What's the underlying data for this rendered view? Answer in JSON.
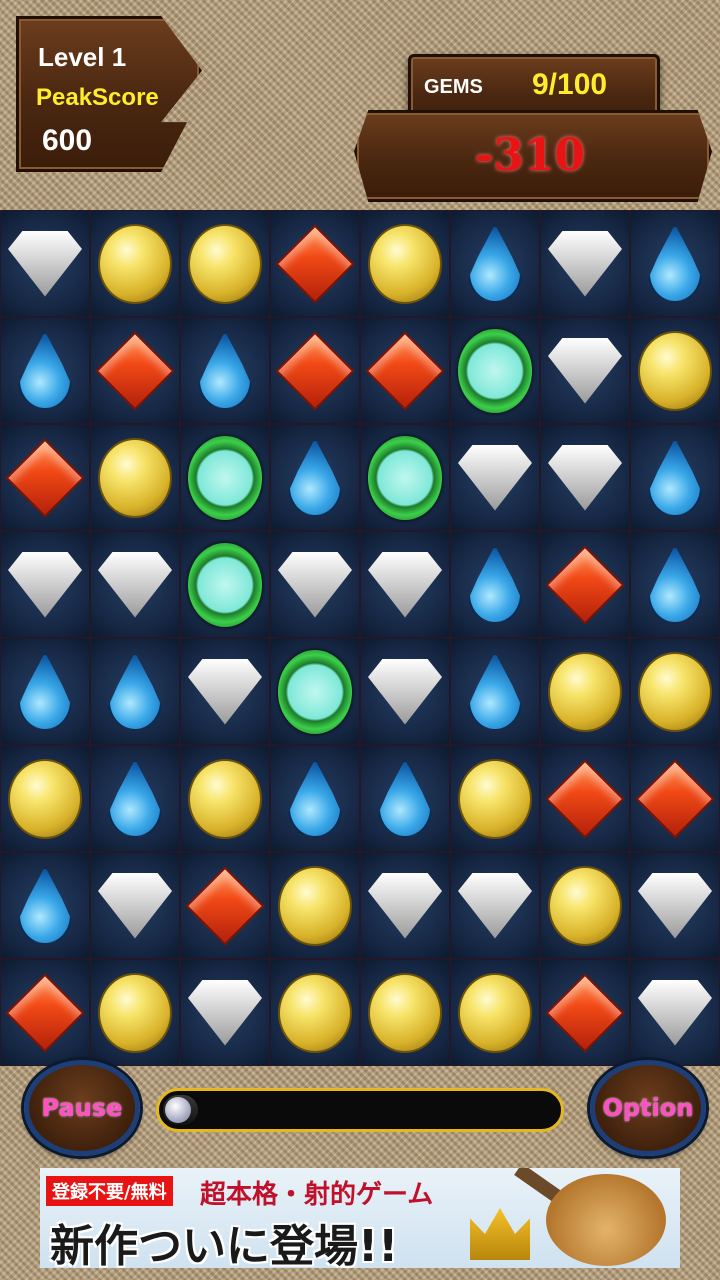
{
  "hud": {
    "level_label": "Level 1",
    "peak_label": "PeakScore",
    "peak_value": "600",
    "gems_label": "GEMS",
    "gems_value": "9/100",
    "score_value": "-310"
  },
  "board": {
    "rows": [
      [
        "white",
        "yellow",
        "yellow",
        "red",
        "yellow",
        "blue",
        "white",
        "blue"
      ],
      [
        "blue",
        "red",
        "blue",
        "red",
        "red",
        "green",
        "white",
        "yellow"
      ],
      [
        "red",
        "yellow",
        "green",
        "blue",
        "green",
        "white",
        "white",
        "blue"
      ],
      [
        "white",
        "white",
        "green",
        "white",
        "white",
        "blue",
        "red",
        "blue"
      ],
      [
        "blue",
        "blue",
        "white",
        "green",
        "white",
        "blue",
        "yellow",
        "yellow"
      ],
      [
        "yellow",
        "blue",
        "yellow",
        "blue",
        "blue",
        "yellow",
        "red",
        "red"
      ],
      [
        "blue",
        "white",
        "red",
        "yellow",
        "white",
        "white",
        "yellow",
        "white"
      ],
      [
        "red",
        "yellow",
        "white",
        "yellow",
        "yellow",
        "yellow",
        "red",
        "white"
      ]
    ]
  },
  "controls": {
    "pause_label": "Pause",
    "option_label": "Option",
    "progress_fraction": 0.09
  },
  "ad": {
    "badge": "登録不要/無料",
    "line1": "超本格・射的ゲーム",
    "line2": "新作ついに登場!!"
  },
  "colors": {
    "score_text": "#e81414",
    "accent_yellow": "#ffec2a",
    "button_text": "#ff4fc0"
  }
}
